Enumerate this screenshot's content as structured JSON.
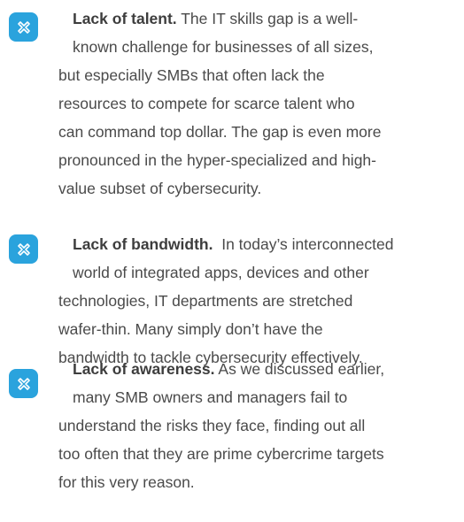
{
  "colors": {
    "icon_bg": "#2aa3dd",
    "text": "#4a4a4a",
    "title": "#3d3d3d"
  },
  "items": [
    {
      "icon": "cross-mark-icon",
      "title": "Lack of talent.",
      "lines": [
        " The IT skills gap is a well-",
        "known challenge for businesses of all sizes,",
        "but especially SMBs that often lack the",
        "resources to compete for scarce talent who",
        "can command top dollar. The gap is even more",
        "pronounced in the hyper-specialized and high-",
        "value subset of cybersecurity."
      ]
    },
    {
      "icon": "cross-mark-icon",
      "title": "Lack of bandwidth.",
      "lines": [
        "  In today’s interconnected",
        "world of integrated apps, devices and other",
        "technologies, IT departments are stretched",
        "wafer-thin. Many simply don’t have the",
        "bandwidth to tackle cybersecurity effectively."
      ]
    },
    {
      "icon": "cross-mark-icon",
      "title": "Lack of awareness.",
      "lines": [
        " As we discussed earlier,",
        "many SMB owners and managers fail to",
        "understand the risks they face, finding out all",
        "too often that they are prime cybercrime targets",
        "for this very reason."
      ]
    }
  ]
}
